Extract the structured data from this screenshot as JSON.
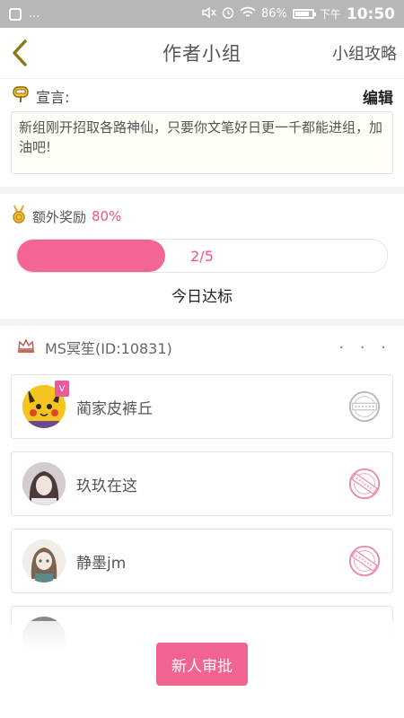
{
  "status_bar": {
    "notification": "...",
    "battery_text": "86%",
    "battery_level": 0.86,
    "ampm": "下午",
    "time": "10:50"
  },
  "header": {
    "title": "作者小组",
    "guide_link": "小组攻略"
  },
  "declaration": {
    "label": "宣言:",
    "edit_label": "编辑",
    "text": "新组刚开招取各路神仙，只要你文笔好日更一千都能进组，加油吧!"
  },
  "reward": {
    "label": "额外奖励",
    "percent": "80%",
    "progress_text": "2/5",
    "progress_fraction": 0.4,
    "status": "今日达标"
  },
  "group": {
    "owner_label": "MS冥笙(ID:10831)",
    "more": "· · ·"
  },
  "members": [
    {
      "name": "蔺家皮裤丘",
      "stamp": "gray",
      "badge": "V"
    },
    {
      "name": "玖玖在这",
      "stamp": "pink"
    },
    {
      "name": "静墨jm",
      "stamp": "pink"
    }
  ],
  "colors": {
    "accent": "#f36592",
    "status_bar": "#b7b7b7",
    "back_arrow": "#8a7a1a"
  },
  "bottom": {
    "approve_button": "新人审批"
  }
}
